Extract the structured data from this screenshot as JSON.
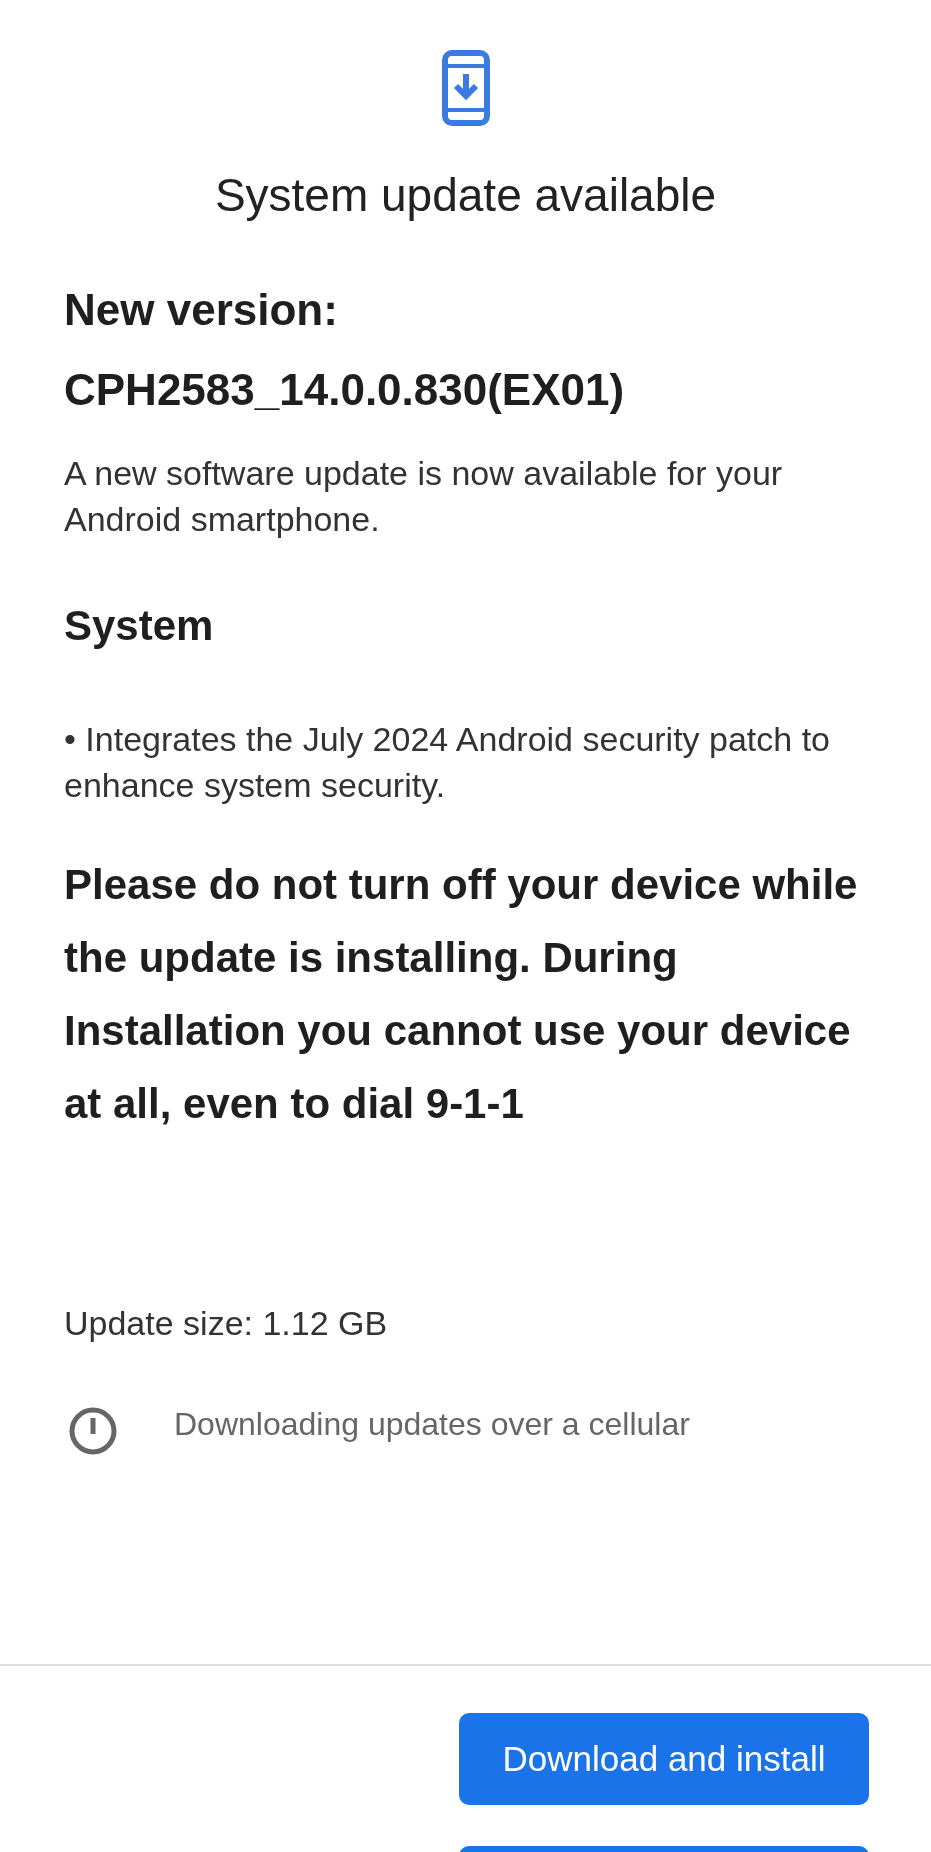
{
  "header": {
    "title": "System update available"
  },
  "version": {
    "label": "New version:",
    "value": "CPH2583_14.0.0.830(EX01)"
  },
  "intro": "A new software update is now available for your Android smartphone.",
  "section": {
    "heading": "System",
    "bullets": [
      "Integrates the July 2024 Android security patch to enhance system security."
    ]
  },
  "bullet_mark": "•",
  "warning": "Please do not turn off your device while the update is installing. During Installation you cannot use your device at all, even to dial 9-1-1",
  "update_size": "Update size: 1.12 GB",
  "notice": "Downloading updates over a cellular",
  "buttons": [
    "Download and install"
  ]
}
